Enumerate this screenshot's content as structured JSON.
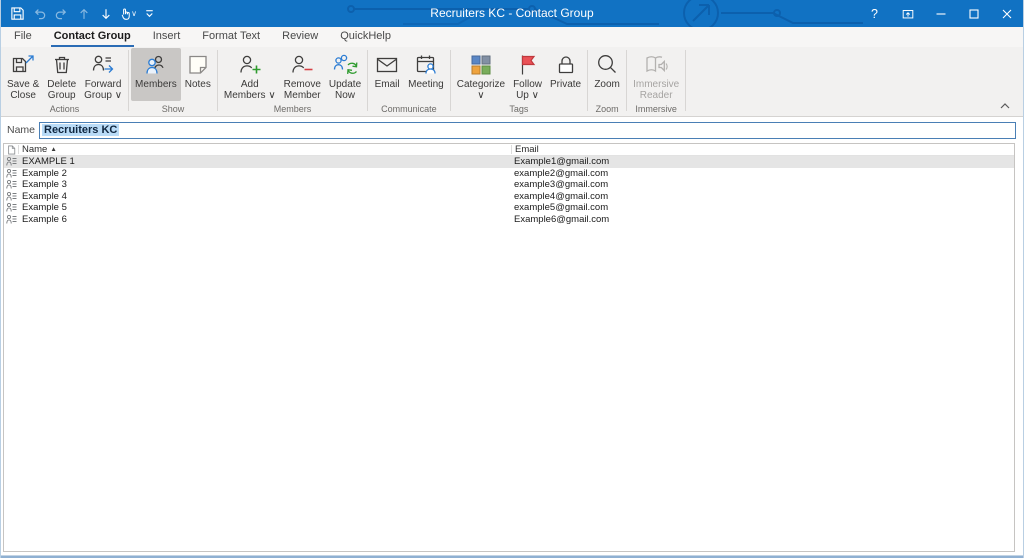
{
  "window": {
    "title": "Recruiters KC - Contact Group",
    "help_label": "?"
  },
  "tabs": [
    {
      "label": "File",
      "active": false
    },
    {
      "label": "Contact Group",
      "active": true
    },
    {
      "label": "Insert",
      "active": false
    },
    {
      "label": "Format Text",
      "active": false
    },
    {
      "label": "Review",
      "active": false
    },
    {
      "label": "QuickHelp",
      "active": false
    }
  ],
  "ribbon": {
    "groups": [
      {
        "label": "Actions",
        "buttons": [
          {
            "line1": "Save &",
            "line2": "Close"
          },
          {
            "line1": "Delete",
            "line2": "Group"
          },
          {
            "line1": "Forward",
            "line2": "Group ∨"
          }
        ]
      },
      {
        "label": "Show",
        "buttons": [
          {
            "line1": "Members",
            "line2": "",
            "selected": true
          },
          {
            "line1": "Notes",
            "line2": ""
          }
        ]
      },
      {
        "label": "Members",
        "buttons": [
          {
            "line1": "Add",
            "line2": "Members ∨"
          },
          {
            "line1": "Remove",
            "line2": "Member"
          },
          {
            "line1": "Update",
            "line2": "Now"
          }
        ]
      },
      {
        "label": "Communicate",
        "buttons": [
          {
            "line1": "Email",
            "line2": ""
          },
          {
            "line1": "Meeting",
            "line2": ""
          }
        ]
      },
      {
        "label": "Tags",
        "buttons": [
          {
            "line1": "Categorize",
            "line2": "∨"
          },
          {
            "line1": "Follow",
            "line2": "Up ∨"
          },
          {
            "line1": "Private",
            "line2": ""
          }
        ]
      },
      {
        "label": "Zoom",
        "buttons": [
          {
            "line1": "Zoom",
            "line2": ""
          }
        ]
      },
      {
        "label": "Immersive",
        "buttons": [
          {
            "line1": "Immersive",
            "line2": "Reader",
            "disabled": true
          }
        ]
      }
    ]
  },
  "name_field": {
    "label": "Name",
    "value": "Recruiters KC"
  },
  "members_table": {
    "columns": [
      "Name",
      "Email"
    ],
    "sort_indicator": "▲",
    "sort": {
      "column": "Name",
      "direction": "asc"
    },
    "rows": [
      {
        "name": "EXAMPLE 1",
        "email": "Example1@gmail.com",
        "selected": true
      },
      {
        "name": "Example 2",
        "email": "example2@gmail.com",
        "selected": false
      },
      {
        "name": "Example 3",
        "email": "example3@gmail.com",
        "selected": false
      },
      {
        "name": "Example 4",
        "email": "example4@gmail.com",
        "selected": false
      },
      {
        "name": "Example 5",
        "email": "example5@gmail.com",
        "selected": false
      },
      {
        "name": "Example 6",
        "email": "Example6@gmail.com",
        "selected": false
      }
    ]
  },
  "colors": {
    "titlebar": "#1172c3",
    "accent": "#2b7cd3",
    "tab_underline": "#2b6cb5",
    "selection_highlight": "#b9dbf7",
    "selected_row": "#e5e5e5"
  }
}
